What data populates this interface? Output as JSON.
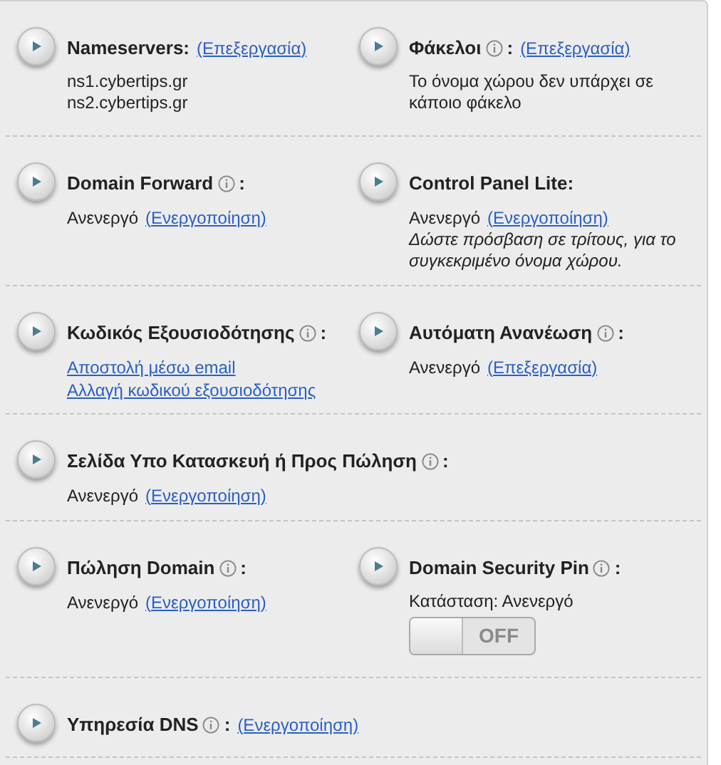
{
  "sections": [
    {
      "cells": [
        {
          "title": "Nameservers:",
          "info": false,
          "header_link": "(Επεξεργασία)",
          "body": [
            {
              "kind": "text",
              "text": "ns1.cybertips.gr"
            },
            {
              "kind": "text",
              "text": "ns2.cybertips.gr"
            }
          ]
        },
        {
          "title": "Φάκελοι",
          "info": true,
          "colon": ":",
          "header_link": "(Επεξεργασία)",
          "body": [
            {
              "kind": "text",
              "text": "Το όνομα χώρου δεν υπάρχει σε κάποιο φάκελο"
            }
          ]
        }
      ]
    },
    {
      "cells": [
        {
          "title": "Domain Forward",
          "info": true,
          "colon": ":",
          "body": [
            {
              "kind": "status",
              "text": "Ανενεργό",
              "link": "(Ενεργοποίηση)"
            }
          ]
        },
        {
          "title": "Control Panel Lite:",
          "info": false,
          "body": [
            {
              "kind": "status",
              "text": "Ανενεργό",
              "link": "(Ενεργοποίηση)"
            },
            {
              "kind": "italic",
              "text": "Δώστε πρόσβαση σε τρίτους, για το συγκεκριμένο όνομα χώρου."
            }
          ]
        }
      ]
    },
    {
      "cells": [
        {
          "title": "Κωδικός Εξουσιοδότησης",
          "info": true,
          "colon": ":",
          "body": [
            {
              "kind": "link",
              "text": "Αποστολή μέσω email"
            },
            {
              "kind": "link",
              "text": "Αλλαγή κωδικού εξουσιοδότησης"
            }
          ]
        },
        {
          "title": "Αυτόματη Ανανέωση",
          "info": true,
          "colon": ":",
          "body": [
            {
              "kind": "status",
              "text": "Ανενεργό",
              "link": "(Επεξεργασία)"
            }
          ]
        }
      ]
    },
    {
      "cells": [
        {
          "title": "Σελίδα Υπο Κατασκευή ή Προς Πώληση",
          "info": true,
          "colon": ":",
          "body": [
            {
              "kind": "status",
              "text": "Ανενεργό",
              "link": "(Ενεργοποίηση)"
            }
          ]
        }
      ]
    },
    {
      "cells": [
        {
          "title": "Πώληση Domain",
          "info": true,
          "colon": ":",
          "body": [
            {
              "kind": "status",
              "text": "Ανενεργό",
              "link": "(Ενεργοποίηση)"
            }
          ]
        },
        {
          "title": "Domain Security Pin",
          "info": true,
          "colon": ":",
          "body": [
            {
              "kind": "text",
              "text": "Κατάσταση: Ανενεργό"
            },
            {
              "kind": "toggle",
              "label": "OFF",
              "on": false
            }
          ]
        }
      ]
    },
    {
      "cells": [
        {
          "title": "Υπηρεσία DNS",
          "info": true,
          "colon": ":",
          "header_link": "(Ενεργοποίηση)"
        }
      ]
    }
  ]
}
